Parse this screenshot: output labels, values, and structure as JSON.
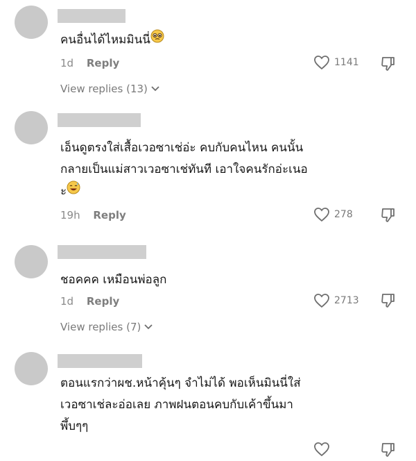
{
  "comments": [
    {
      "text": "คนอื่นได้ไหมมินนี่",
      "emoji": "pleading-face",
      "time": "1d",
      "reply_label": "Reply",
      "likes": "1141",
      "view_replies": "View replies (13)"
    },
    {
      "text": "เอ็นดูตรงใส่เสื้อเวอซาเช่อ่ะ คบกับคนไหน คนนั้น\nกลายเป็นแม่สาวเวอซาเช่ทันที เอาใจคนรักอ่ะเนอ\nะ",
      "emoji": "grinning-sweat-face",
      "time": "19h",
      "reply_label": "Reply",
      "likes": "278"
    },
    {
      "text": "ชอคคค เหมือนพ่อลูก",
      "time": "1d",
      "reply_label": "Reply",
      "likes": "2713",
      "view_replies": "View replies (7)"
    },
    {
      "text": "ตอนแรกว่าผช.หน้าคุ้นๆ จำไม่ได้ พอเห็นมินนี่ใส่\nเวอซาเช่ละอ่อเลย ภาพฝนตอนคบกับเค้าขึ้นมา\nพึ้บๆๆ"
    }
  ],
  "colors": {
    "avatar": "#c9c9c9",
    "meta_text": "#8a8a8a",
    "body_text": "#161616"
  }
}
